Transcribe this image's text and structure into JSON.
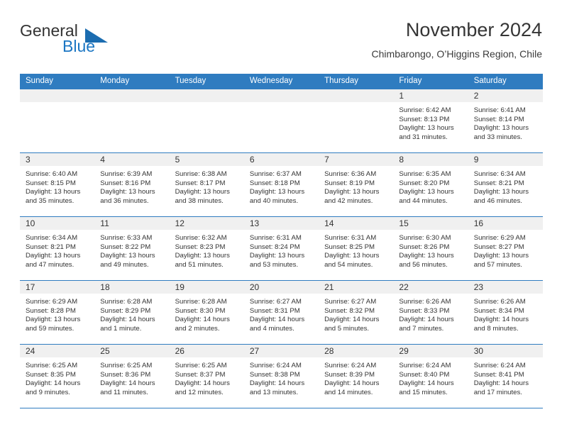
{
  "brand": {
    "name_part1": "General",
    "name_part2": "Blue",
    "triangle_icon": "triangle-icon",
    "color_primary": "#1b6cb0",
    "color_text": "#333333"
  },
  "header": {
    "title": "November 2024",
    "subtitle": "Chimbarongo, O’Higgins Region, Chile"
  },
  "calendar": {
    "header_bg": "#2f7cc0",
    "daynum_bg": "#f0f0f0",
    "weekdays": [
      "Sunday",
      "Monday",
      "Tuesday",
      "Wednesday",
      "Thursday",
      "Friday",
      "Saturday"
    ],
    "weeks": [
      [
        {
          "day": "",
          "sunrise": "",
          "sunset": "",
          "daylight": ""
        },
        {
          "day": "",
          "sunrise": "",
          "sunset": "",
          "daylight": ""
        },
        {
          "day": "",
          "sunrise": "",
          "sunset": "",
          "daylight": ""
        },
        {
          "day": "",
          "sunrise": "",
          "sunset": "",
          "daylight": ""
        },
        {
          "day": "",
          "sunrise": "",
          "sunset": "",
          "daylight": ""
        },
        {
          "day": "1",
          "sunrise": "Sunrise: 6:42 AM",
          "sunset": "Sunset: 8:13 PM",
          "daylight": "Daylight: 13 hours and 31 minutes."
        },
        {
          "day": "2",
          "sunrise": "Sunrise: 6:41 AM",
          "sunset": "Sunset: 8:14 PM",
          "daylight": "Daylight: 13 hours and 33 minutes."
        }
      ],
      [
        {
          "day": "3",
          "sunrise": "Sunrise: 6:40 AM",
          "sunset": "Sunset: 8:15 PM",
          "daylight": "Daylight: 13 hours and 35 minutes."
        },
        {
          "day": "4",
          "sunrise": "Sunrise: 6:39 AM",
          "sunset": "Sunset: 8:16 PM",
          "daylight": "Daylight: 13 hours and 36 minutes."
        },
        {
          "day": "5",
          "sunrise": "Sunrise: 6:38 AM",
          "sunset": "Sunset: 8:17 PM",
          "daylight": "Daylight: 13 hours and 38 minutes."
        },
        {
          "day": "6",
          "sunrise": "Sunrise: 6:37 AM",
          "sunset": "Sunset: 8:18 PM",
          "daylight": "Daylight: 13 hours and 40 minutes."
        },
        {
          "day": "7",
          "sunrise": "Sunrise: 6:36 AM",
          "sunset": "Sunset: 8:19 PM",
          "daylight": "Daylight: 13 hours and 42 minutes."
        },
        {
          "day": "8",
          "sunrise": "Sunrise: 6:35 AM",
          "sunset": "Sunset: 8:20 PM",
          "daylight": "Daylight: 13 hours and 44 minutes."
        },
        {
          "day": "9",
          "sunrise": "Sunrise: 6:34 AM",
          "sunset": "Sunset: 8:21 PM",
          "daylight": "Daylight: 13 hours and 46 minutes."
        }
      ],
      [
        {
          "day": "10",
          "sunrise": "Sunrise: 6:34 AM",
          "sunset": "Sunset: 8:21 PM",
          "daylight": "Daylight: 13 hours and 47 minutes."
        },
        {
          "day": "11",
          "sunrise": "Sunrise: 6:33 AM",
          "sunset": "Sunset: 8:22 PM",
          "daylight": "Daylight: 13 hours and 49 minutes."
        },
        {
          "day": "12",
          "sunrise": "Sunrise: 6:32 AM",
          "sunset": "Sunset: 8:23 PM",
          "daylight": "Daylight: 13 hours and 51 minutes."
        },
        {
          "day": "13",
          "sunrise": "Sunrise: 6:31 AM",
          "sunset": "Sunset: 8:24 PM",
          "daylight": "Daylight: 13 hours and 53 minutes."
        },
        {
          "day": "14",
          "sunrise": "Sunrise: 6:31 AM",
          "sunset": "Sunset: 8:25 PM",
          "daylight": "Daylight: 13 hours and 54 minutes."
        },
        {
          "day": "15",
          "sunrise": "Sunrise: 6:30 AM",
          "sunset": "Sunset: 8:26 PM",
          "daylight": "Daylight: 13 hours and 56 minutes."
        },
        {
          "day": "16",
          "sunrise": "Sunrise: 6:29 AM",
          "sunset": "Sunset: 8:27 PM",
          "daylight": "Daylight: 13 hours and 57 minutes."
        }
      ],
      [
        {
          "day": "17",
          "sunrise": "Sunrise: 6:29 AM",
          "sunset": "Sunset: 8:28 PM",
          "daylight": "Daylight: 13 hours and 59 minutes."
        },
        {
          "day": "18",
          "sunrise": "Sunrise: 6:28 AM",
          "sunset": "Sunset: 8:29 PM",
          "daylight": "Daylight: 14 hours and 1 minute."
        },
        {
          "day": "19",
          "sunrise": "Sunrise: 6:28 AM",
          "sunset": "Sunset: 8:30 PM",
          "daylight": "Daylight: 14 hours and 2 minutes."
        },
        {
          "day": "20",
          "sunrise": "Sunrise: 6:27 AM",
          "sunset": "Sunset: 8:31 PM",
          "daylight": "Daylight: 14 hours and 4 minutes."
        },
        {
          "day": "21",
          "sunrise": "Sunrise: 6:27 AM",
          "sunset": "Sunset: 8:32 PM",
          "daylight": "Daylight: 14 hours and 5 minutes."
        },
        {
          "day": "22",
          "sunrise": "Sunrise: 6:26 AM",
          "sunset": "Sunset: 8:33 PM",
          "daylight": "Daylight: 14 hours and 7 minutes."
        },
        {
          "day": "23",
          "sunrise": "Sunrise: 6:26 AM",
          "sunset": "Sunset: 8:34 PM",
          "daylight": "Daylight: 14 hours and 8 minutes."
        }
      ],
      [
        {
          "day": "24",
          "sunrise": "Sunrise: 6:25 AM",
          "sunset": "Sunset: 8:35 PM",
          "daylight": "Daylight: 14 hours and 9 minutes."
        },
        {
          "day": "25",
          "sunrise": "Sunrise: 6:25 AM",
          "sunset": "Sunset: 8:36 PM",
          "daylight": "Daylight: 14 hours and 11 minutes."
        },
        {
          "day": "26",
          "sunrise": "Sunrise: 6:25 AM",
          "sunset": "Sunset: 8:37 PM",
          "daylight": "Daylight: 14 hours and 12 minutes."
        },
        {
          "day": "27",
          "sunrise": "Sunrise: 6:24 AM",
          "sunset": "Sunset: 8:38 PM",
          "daylight": "Daylight: 14 hours and 13 minutes."
        },
        {
          "day": "28",
          "sunrise": "Sunrise: 6:24 AM",
          "sunset": "Sunset: 8:39 PM",
          "daylight": "Daylight: 14 hours and 14 minutes."
        },
        {
          "day": "29",
          "sunrise": "Sunrise: 6:24 AM",
          "sunset": "Sunset: 8:40 PM",
          "daylight": "Daylight: 14 hours and 15 minutes."
        },
        {
          "day": "30",
          "sunrise": "Sunrise: 6:24 AM",
          "sunset": "Sunset: 8:41 PM",
          "daylight": "Daylight: 14 hours and 17 minutes."
        }
      ]
    ]
  }
}
